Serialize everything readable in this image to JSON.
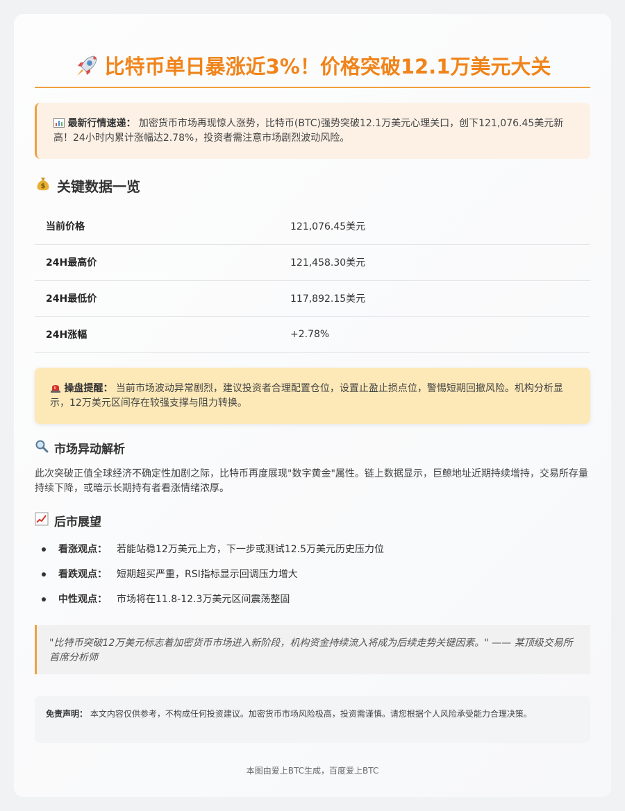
{
  "title": "比特币单日暴涨近3%！价格突破12.1万美元大关",
  "news": {
    "label": "最新行情速递：",
    "text": "加密货币市场再现惊人涨势，比特币(BTC)强势突破12.1万美元心理关口，创下121,076.45美元新高！24小时内累计涨幅达2.78%，投资者需注意市场剧烈波动风险。"
  },
  "key_data": {
    "heading": "关键数据一览",
    "rows": [
      {
        "label": "当前价格",
        "value": "121,076.45美元"
      },
      {
        "label": "24H最高价",
        "value": "121,458.30美元"
      },
      {
        "label": "24H最低价",
        "value": "117,892.15美元"
      },
      {
        "label": "24H涨幅",
        "value": "+2.78%"
      }
    ]
  },
  "warning": {
    "label": "操盘提醒：",
    "text": "当前市场波动异常剧烈，建议投资者合理配置仓位，设置止盈止损点位，警惕短期回撤风险。机构分析显示，12万美元区间存在较强支撑与阻力转换。"
  },
  "analysis": {
    "heading": "市场异动解析",
    "text": "此次突破正值全球经济不确定性加剧之际，比特币再度展现\"数字黄金\"属性。链上数据显示，巨鲸地址近期持续增持，交易所存量持续下降，或暗示长期持有者看涨情绪浓厚。"
  },
  "outlook": {
    "heading": "后市展望",
    "items": [
      {
        "label": "看涨观点：",
        "text": "若能站稳12万美元上方，下一步或测试12.5万美元历史压力位"
      },
      {
        "label": "看跌观点：",
        "text": "短期超买严重，RSI指标显示回调压力增大"
      },
      {
        "label": "中性观点：",
        "text": "市场将在11.8-12.3万美元区间震荡整固"
      }
    ]
  },
  "quote": "\"比特币突破12万美元标志着加密货币市场进入新阶段，机构资金持续流入将成为后续走势关键因素。\" —— 某顶级交易所首席分析师",
  "disclaimer": {
    "label": "免责声明：",
    "text": "本文内容仅供参考，不构成任何投资建议。加密货币市场风险极高，投资需谨慎。请您根据个人风险承受能力合理决策。"
  },
  "footer": "本图由爱上BTC生成，百度爱上BTC",
  "icons": [
    "rocket-icon",
    "bar-chart-icon",
    "money-bag-icon",
    "siren-icon",
    "magnifier-icon",
    "trend-chart-icon"
  ],
  "colors": {
    "accent": "#f0841a",
    "news_bg": "#fdf1e6",
    "warn_bg": "#fde9b8"
  }
}
